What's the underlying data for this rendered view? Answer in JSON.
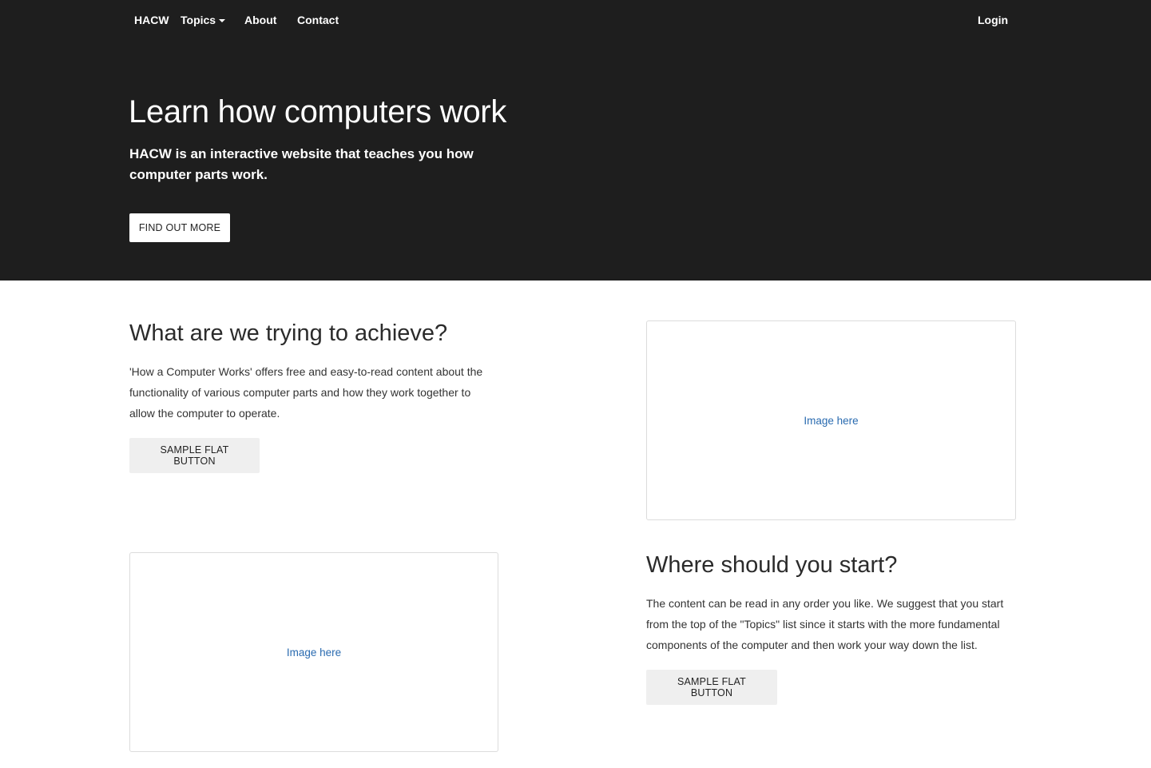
{
  "nav": {
    "brand": "HACW",
    "topics": "Topics",
    "about": "About",
    "contact": "Contact",
    "login": "Login"
  },
  "hero": {
    "title": "Learn how computers work",
    "subtitle": "HACW is an interactive website that teaches you how computer parts work.",
    "button": "FIND OUT MORE"
  },
  "sections": [
    {
      "title": "What are we trying to achieve?",
      "text": "'How a Computer Works' offers free and easy-to-read content about the functionality of various computer parts and how they work together to allow the computer to operate.",
      "button": "SAMPLE FLAT BUTTON",
      "image_placeholder": "Image here"
    },
    {
      "title": "Where should you start?",
      "text": "The content can be read in any order you like. We suggest that you start from the top of the \"Topics\" list since it starts with the more fundamental components of the computer and then work your way down the list.",
      "button": "SAMPLE FLAT BUTTON",
      "image_placeholder": "Image here"
    }
  ],
  "colors": {
    "hero_bg": "#1e1e1e",
    "link_blue": "#2a6bb0",
    "flat_button_bg": "#efefef"
  }
}
